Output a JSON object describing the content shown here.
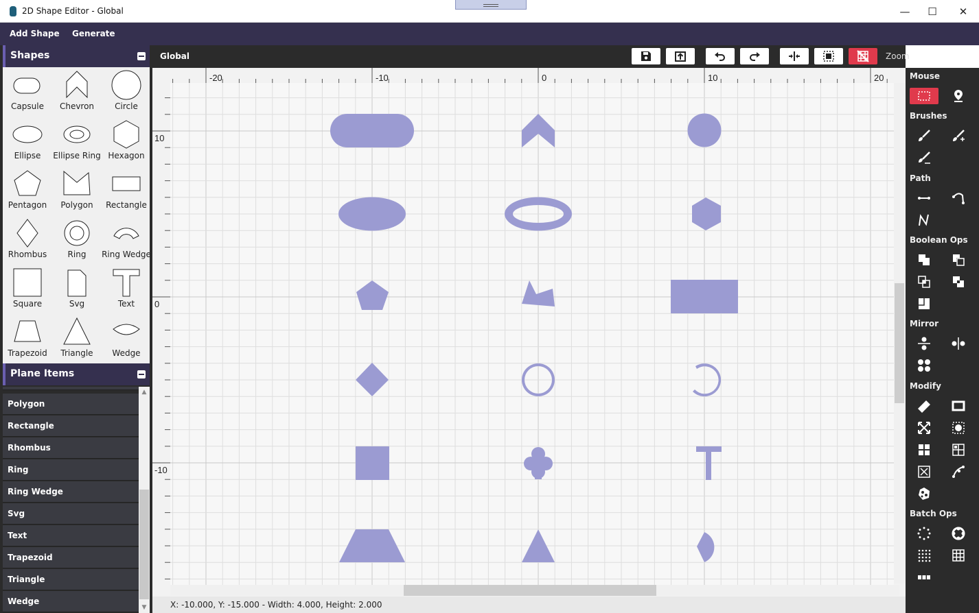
{
  "window": {
    "title": "2D Shape Editor - Global",
    "minimize": "—",
    "maximize": "☐",
    "close": "✕"
  },
  "menu": {
    "add_shape": "Add Shape",
    "generate": "Generate"
  },
  "shapes_panel": {
    "title": "Shapes",
    "items": [
      "Capsule",
      "Chevron",
      "Circle",
      "Ellipse",
      "Ellipse Ring",
      "Hexagon",
      "Pentagon",
      "Polygon",
      "Rectangle",
      "Rhombus",
      "Ring",
      "Ring Wedge",
      "Square",
      "Svg",
      "Text",
      "Trapezoid",
      "Triangle",
      "Wedge"
    ]
  },
  "plane_panel": {
    "title": "Plane Items",
    "items": [
      "Polygon",
      "Rectangle",
      "Rhombus",
      "Ring",
      "Ring Wedge",
      "Svg",
      "Text",
      "Trapezoid",
      "Triangle",
      "Wedge"
    ]
  },
  "toolbar": {
    "plane": "Global",
    "zoom_label": "Zoom",
    "buttons": [
      "save-icon",
      "export-icon",
      "undo-icon",
      "redo-icon",
      "fit-width-icon",
      "select-frame-icon",
      "grid-toggle-icon",
      "zoom-in-icon",
      "zoom-out-icon"
    ]
  },
  "canvas": {
    "x_ticks": [
      "-20",
      "-10",
      "0",
      "10",
      "20"
    ],
    "y_ticks": [
      "10",
      "0",
      "-10"
    ],
    "shape_color": "#9b9bd2"
  },
  "status": {
    "text": "X: -10.000, Y: -15.000 - Width: 4.000, Height: 2.000"
  },
  "right_panel": {
    "sections": {
      "mouse": "Mouse",
      "brushes": "Brushes",
      "path": "Path",
      "boolean": "Boolean Ops",
      "mirror": "Mirror",
      "modify": "Modify",
      "batch": "Batch Ops"
    }
  },
  "colors": {
    "accent": "#e03a4c",
    "header": "#35304f",
    "panel": "#2b2b2b"
  }
}
